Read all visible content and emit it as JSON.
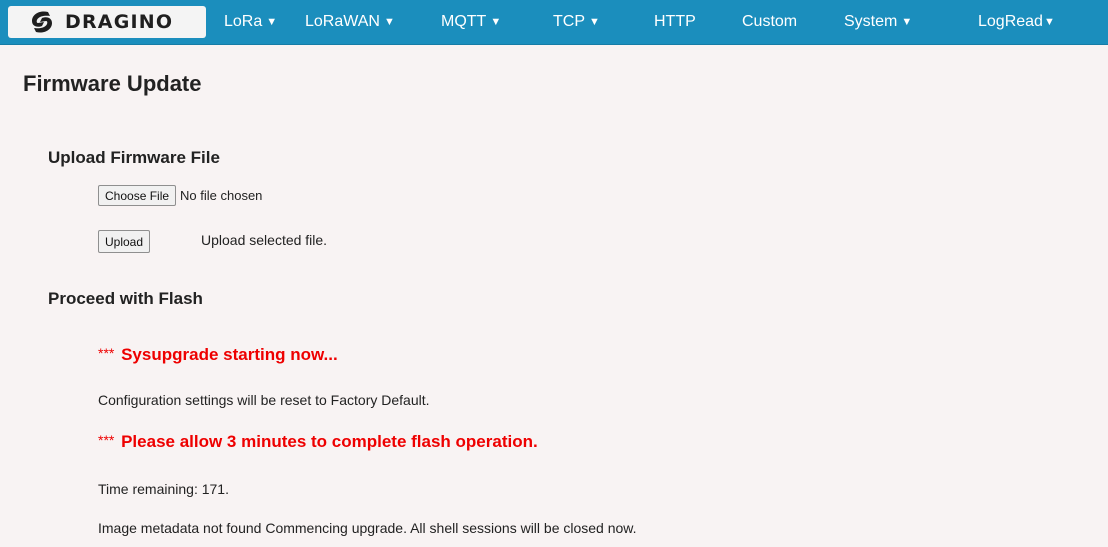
{
  "navbar": {
    "brand": "DRAGINO",
    "brand_color": "#1b8ebd",
    "items": [
      {
        "label": "LoRa",
        "icon": "caret-down-icon"
      },
      {
        "label": "LoRaWAN",
        "icon": "caret-down-icon"
      },
      {
        "label": "MQTT",
        "icon": "caret-down-icon"
      },
      {
        "label": "TCP",
        "icon": "caret-down-icon"
      },
      {
        "label": "HTTP"
      },
      {
        "label": "Custom"
      },
      {
        "label": "System",
        "icon": "caret-down-icon"
      },
      {
        "label": "LogRead",
        "icon": "caret-down-icon"
      }
    ]
  },
  "page": {
    "title": "Firmware Update"
  },
  "upload_section": {
    "title": "Upload Firmware File",
    "choose_file_label": "Choose File",
    "file_status": "No file chosen",
    "upload_label": "Upload",
    "upload_description": "Upload selected file."
  },
  "flash_section": {
    "title": "Proceed with Flash",
    "alert_prefix": "***",
    "alert_color": "#ee0000",
    "alert_starting": "Sysupgrade starting now...",
    "reset_notice": "Configuration settings will be reset to Factory Default.",
    "alert_allow": "Please allow 3 minutes to complete flash operation.",
    "time_remaining": "Time remaining: 171.",
    "log_message": "Image metadata not found Commencing upgrade. All shell sessions will be closed now."
  }
}
